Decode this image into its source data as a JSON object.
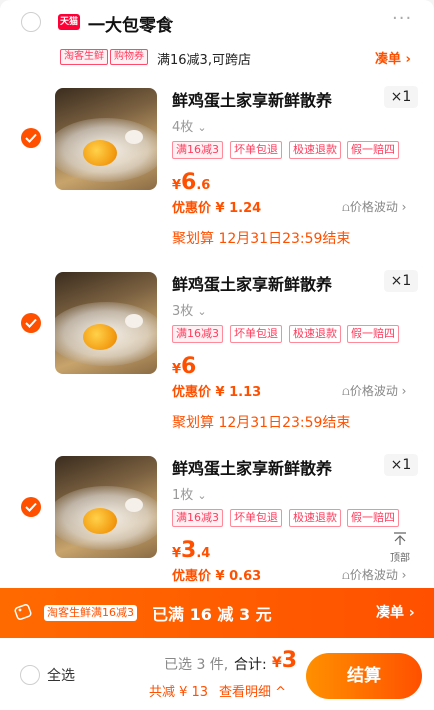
{
  "store": {
    "badge": "天猫",
    "name": "一大包零食",
    "chevron": "›",
    "more": "···",
    "tags": [
      "淘客生鲜",
      "购物券"
    ],
    "promo": "满16减3,可跨店",
    "cou": "凑单 ›"
  },
  "items": [
    {
      "title": "鲜鸡蛋土家享新鲜散养",
      "qty": "×1",
      "spec": "4枚",
      "tags": [
        "满16减3",
        "坏单包退",
        "极速退款",
        "假一赔四"
      ],
      "yen": "¥",
      "price_int": "6",
      "price_dec": ".6",
      "deal_label": "优惠价",
      "deal_price": "¥ 1.24",
      "price_wave": "价格波动",
      "flash": "聚划算 12月31日23:59结束"
    },
    {
      "title": "鲜鸡蛋土家享新鲜散养",
      "qty": "×1",
      "spec": "3枚",
      "tags": [
        "满16减3",
        "坏单包退",
        "极速退款",
        "假一赔四"
      ],
      "yen": "¥",
      "price_int": "6",
      "price_dec": "",
      "deal_label": "优惠价",
      "deal_price": "¥ 1.13",
      "price_wave": "价格波动",
      "flash": "聚划算 12月31日23:59结束"
    },
    {
      "title": "鲜鸡蛋土家享新鲜散养",
      "qty": "×1",
      "spec": "1枚",
      "tags": [
        "满16减3",
        "坏单包退",
        "极速退款",
        "假一赔四"
      ],
      "yen": "¥",
      "price_int": "3",
      "price_dec": ".4",
      "deal_label": "优惠价",
      "deal_price": "¥ 0.63",
      "price_wave": "价格波动",
      "flash": ""
    }
  ],
  "to_top": "顶部",
  "banner": {
    "tag": "淘客生鲜满16减3",
    "text": "已满 16 减 3 元",
    "cou": "凑单 ›"
  },
  "footer": {
    "select_all": "全选",
    "selected": "已选 3 件,",
    "total_label": "合计:",
    "total_yen": "¥",
    "total_value": "3",
    "saving": "共减 ¥ 13",
    "detail": "查看明细 ^",
    "checkout": "结算"
  },
  "colors": {
    "accent": "#ff5000",
    "tag_red": "#ff3c5c"
  }
}
